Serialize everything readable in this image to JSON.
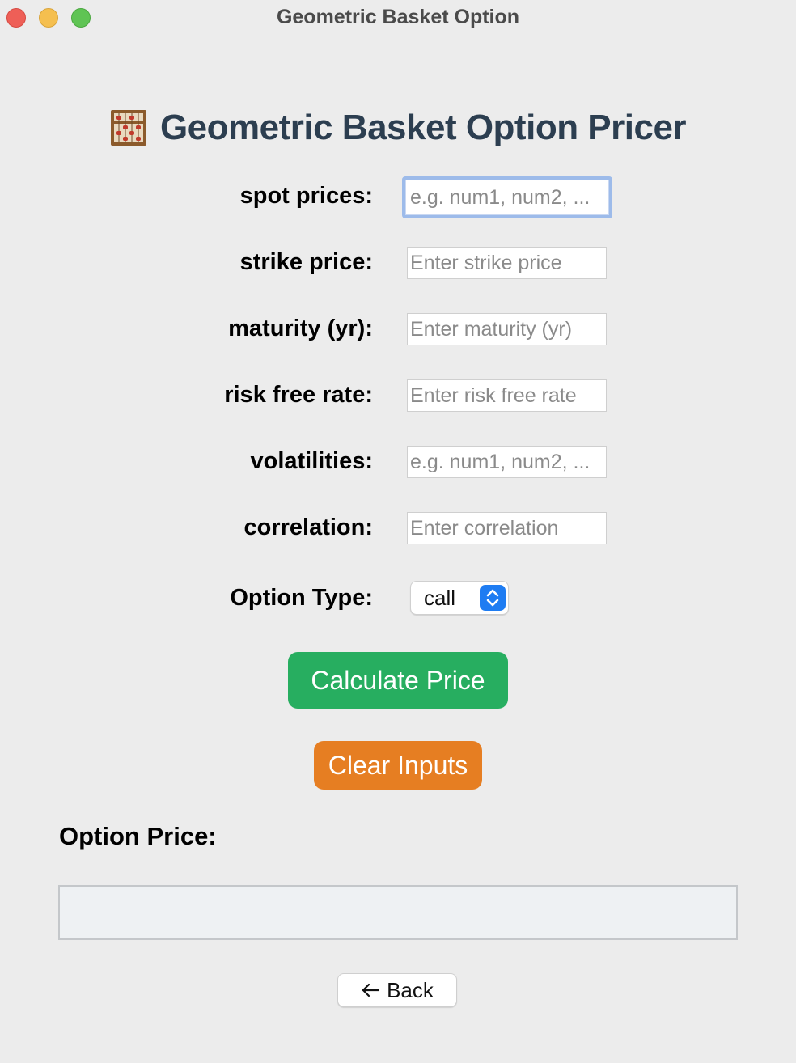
{
  "window": {
    "title": "Geometric Basket Option"
  },
  "heading": {
    "icon": "abacus-icon",
    "text": "Geometric Basket Option Pricer"
  },
  "form": {
    "fields": [
      {
        "label": "spot prices:",
        "placeholder": "e.g. num1, num2, ...",
        "value": ""
      },
      {
        "label": "strike price:",
        "placeholder": "Enter strike price",
        "value": ""
      },
      {
        "label": "maturity (yr):",
        "placeholder": "Enter maturity (yr)",
        "value": ""
      },
      {
        "label": "risk free rate:",
        "placeholder": "Enter risk free rate",
        "value": ""
      },
      {
        "label": "volatilities:",
        "placeholder": "e.g. num1, num2, ...",
        "value": ""
      },
      {
        "label": "correlation:",
        "placeholder": "Enter correlation",
        "value": ""
      }
    ],
    "option_type": {
      "label": "Option Type:",
      "selected": "call"
    }
  },
  "buttons": {
    "calculate": "Calculate Price",
    "clear": "Clear Inputs",
    "back": "Back"
  },
  "result": {
    "label": "Option Price:",
    "value": ""
  },
  "colors": {
    "heading": "#2c3e50",
    "calculate": "#27ae60",
    "clear": "#e67e22",
    "select_accent": "#1e7cf2",
    "focus_ring": "#9dbbea"
  }
}
